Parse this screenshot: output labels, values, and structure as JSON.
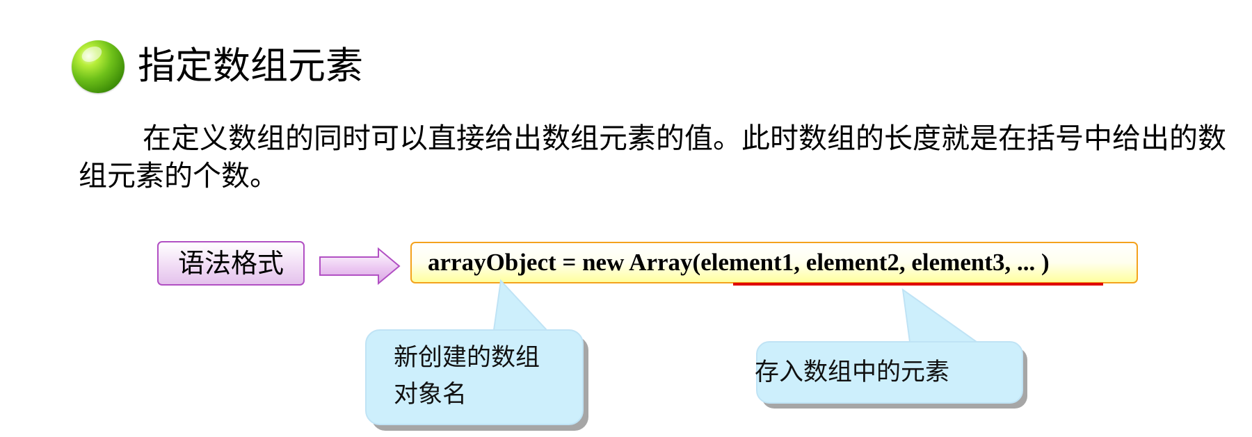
{
  "title": "指定数组元素",
  "paragraph": "在定义数组的同时可以直接给出数组元素的值。此时数组的长度就是在括号中给出的数组元素的个数。",
  "syntax": {
    "label": "语法格式",
    "code_prefix": "arrayObject = new Array(",
    "code_args": "element1, element2, element3, ...",
    "code_suffix": " )"
  },
  "callouts": {
    "object_name": [
      "新创建的数组",
      "对象名"
    ],
    "elements": "存入数组中的元素"
  },
  "colors": {
    "bullet": "#6fc11a",
    "label_border": "#b14fc3",
    "arrow_fill": "#d9a7e3",
    "code_border": "#f4a21c",
    "code_fill": "#ffff9e",
    "underline": "#e00000",
    "callout_fill": "#cdeffc",
    "callout_shadow": "#a6a6a6"
  }
}
